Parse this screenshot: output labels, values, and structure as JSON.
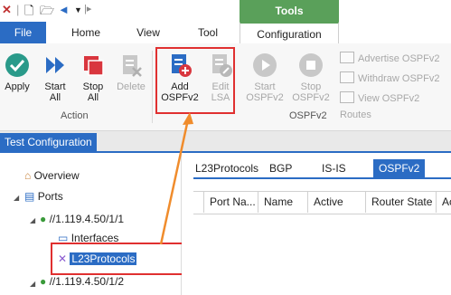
{
  "ribbon_tabs": {
    "file": "File",
    "home": "Home",
    "view": "View",
    "tool": "Tool",
    "tools_context": "Tools",
    "configuration": "Configuration"
  },
  "action_group": {
    "label": "Action",
    "apply": "Apply",
    "start_all_1": "Start",
    "start_all_2": "All",
    "stop_all_1": "Stop",
    "stop_all_2": "All",
    "delete": "Delete"
  },
  "ospf_group": {
    "label": "OSPFv2",
    "add_1": "Add",
    "add_2": "OSPFv2",
    "edit_1": "Edit",
    "edit_2": "LSA",
    "start_1": "Start",
    "start_2": "OSPFv2",
    "stop_1": "Stop",
    "stop_2": "OSPFv2",
    "advertise": "Advertise OSPFv2",
    "withdraw": "Withdraw OSPFv2",
    "view_routes": "View OSPFv2 Routes"
  },
  "doc_tab": "Test Configuration",
  "tree": {
    "overview": "Overview",
    "ports": "Ports",
    "port1": "//1.119.4.50/1/1",
    "interfaces": "Interfaces",
    "l23": "L23Protocols",
    "port2": "//1.119.4.50/1/2"
  },
  "protocol_tabs": [
    "L23Protocols",
    "BGP",
    "IS-IS",
    "OSPFv2"
  ],
  "grid_columns": [
    "Port Na...",
    "Name",
    "Active",
    "Router State",
    "Ac"
  ],
  "colors": {
    "file_tab": "#2b6cc4",
    "tools_context": "#5aa05a",
    "highlight_box": "#e03030",
    "arrow": "#f08c2c"
  }
}
